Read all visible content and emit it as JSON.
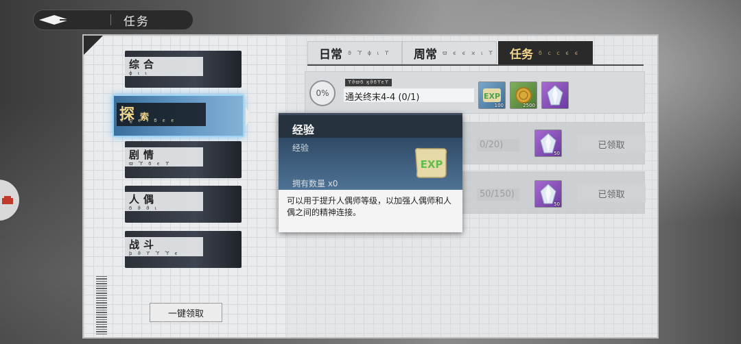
{
  "header": {
    "title": "任务"
  },
  "categories": [
    {
      "name": "综合",
      "rune": "ϕ ι ι"
    },
    {
      "name": "探",
      "sub": "索",
      "rune": "ϵ ϱ ϵ ι ϭ ϵ ϵ"
    },
    {
      "name": "剧情",
      "rune": "ϖ ϓ ϭ ϵ ϒ"
    },
    {
      "name": "人偶",
      "rune": "ϭ ϑ ϑ ι"
    },
    {
      "name": "战斗",
      "rune": "ϸ ϑ ϒ ϓ ϓ ϵ"
    }
  ],
  "claim_all_label": "一键领取",
  "tabs": [
    {
      "label": "日常",
      "rune": "ϑ ϓ ϕ ι ϒ"
    },
    {
      "label": "周常",
      "rune": "ϖ ϵ ϵ ϰ ι ϒ"
    },
    {
      "label": "任务",
      "rune": "ϭ ϲ ϲ ϵ ϵ"
    }
  ],
  "tasks": [
    {
      "progress": "0%",
      "tag": "ϒϑϖϭ ϗϑϭϒϵϒ",
      "title": "通关终末4-4 (0/1)",
      "rewards": [
        {
          "icon": "exp-scroll-icon",
          "qty": "100"
        },
        {
          "icon": "gold-coin-icon",
          "qty": "2500"
        },
        {
          "icon": "crystal-icon",
          "qty": ""
        }
      ]
    },
    {
      "partial": "0/20)",
      "reward_qty": "50",
      "status": "已领取"
    },
    {
      "partial": "50/150)",
      "reward_qty": "50",
      "status": "已领取"
    }
  ],
  "tooltip": {
    "title": "经验",
    "category": "经验",
    "owned": "拥有数量 x0",
    "description": "可以用于提升人偶师等级，以加强人偶师和人偶之间的精神连接。",
    "icon": "exp-scroll-icon"
  },
  "colors": {
    "accent_gold": "#f1d58a",
    "active_blue": "#5f95c2",
    "dark": "#2a2a2a"
  }
}
